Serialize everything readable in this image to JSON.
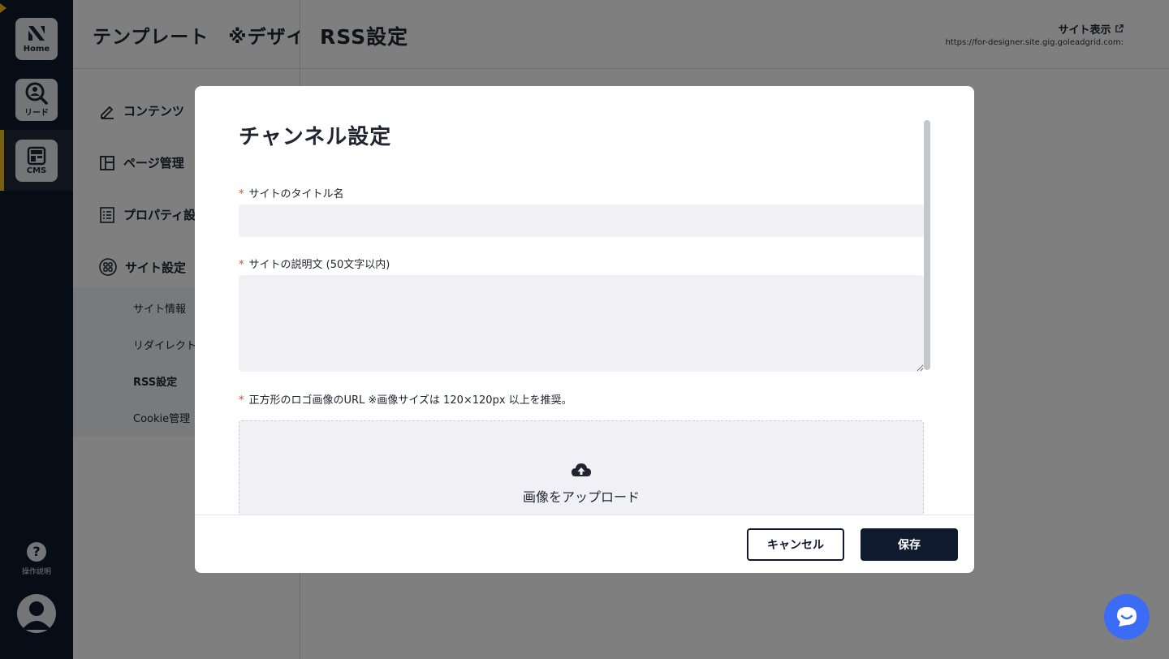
{
  "rail": {
    "home_label": "Home",
    "lead_label": "リード",
    "cms_label": "CMS",
    "help_label": "操作説明",
    "accent_color": "#f2c21b"
  },
  "sidebar": {
    "title": "テンプレート　※デザイナ",
    "items": [
      {
        "label": "コンテンツ",
        "icon": "pencil-icon"
      },
      {
        "label": "ページ管理",
        "icon": "layout-icon"
      },
      {
        "label": "プロパティ設",
        "icon": "checklist-icon"
      },
      {
        "label": "サイト設定",
        "icon": "grid-icon"
      }
    ],
    "sub_items": [
      {
        "label": "サイト情報"
      },
      {
        "label": "リダイレクト"
      },
      {
        "label": "RSS設定"
      },
      {
        "label": "Cookie管理"
      }
    ]
  },
  "header": {
    "title": "RSS設定",
    "site_link_label": "サイト表示",
    "site_url": "https://for-designer.site.gig.goleadgrid.com:"
  },
  "modal": {
    "title": "チャンネル設定",
    "fields": {
      "site_title_label": "サイトのタイトル名",
      "site_title_value": "",
      "site_desc_label": "サイトの説明文 (50文字以内)",
      "site_desc_value": "",
      "logo_label": "正方形のロゴ画像のURL ※画像サイズは 120×120px 以上を推奨。",
      "upload_label": "画像をアップロード",
      "required_mark": "*"
    },
    "buttons": {
      "cancel": "キャンセル",
      "save": "保存"
    }
  },
  "colors": {
    "navy": "#0f1a2e",
    "required": "#e0443a",
    "chat": "#3b6cf6"
  }
}
